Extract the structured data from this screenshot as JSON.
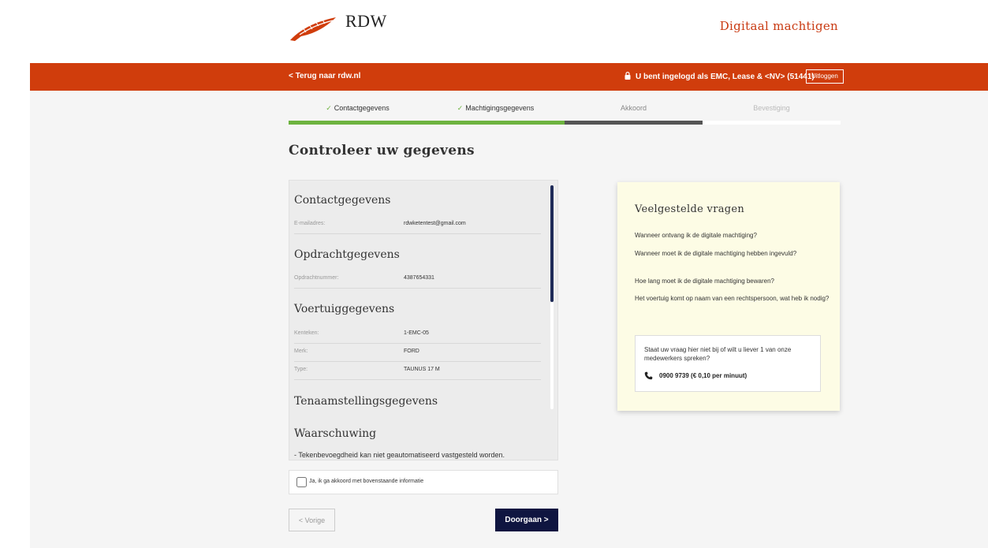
{
  "header": {
    "logo_text": "RDW",
    "app_title": "Digitaal machtigen"
  },
  "navbar": {
    "back_link": "< Terug naar rdw.nl",
    "login_info": "U bent ingelogd als EMC, Lease & <NV> (51441)",
    "logout_label": "Uitloggen"
  },
  "steps": [
    {
      "label": "Contactgegevens",
      "state": "done",
      "progress": 1.0
    },
    {
      "label": "Machtigingsgegevens",
      "state": "done",
      "progress": 1.0
    },
    {
      "label": "Akkoord",
      "state": "current",
      "progress": 1.0
    },
    {
      "label": "Bevestiging",
      "state": "future",
      "progress": 0.0
    }
  ],
  "colors": {
    "brand_red": "#d03d0c",
    "progress_done": "#6db33f",
    "progress_current": "#555555",
    "primary_button": "#0f1540"
  },
  "page_title": "Controleer uw gegevens",
  "details": {
    "contact_title": "Contactgegevens",
    "email_label": "E-mailadres:",
    "email_value": "rdwketentest@gmail.com",
    "order_title": "Opdrachtgegevens",
    "order_label": "Opdrachtnummer:",
    "order_value": "4387654331",
    "vehicle_title": "Voertuiggegevens",
    "plate_label": "Kenteken:",
    "plate_value": "1-EMC-05",
    "brand_label": "Merk:",
    "brand_value": "FORD",
    "type_label": "Type:",
    "type_value": "TAUNUS 17 M",
    "registration_title": "Tenaamstellingsgegevens",
    "warning_title": "Waarschuwing",
    "warning_text": "- Tekenbevoegdheid kan niet geautomatiseerd vastgesteld worden."
  },
  "agree_label": "Ja, ik ga akkoord met bovenstaande informatie",
  "buttons": {
    "prev": "< Vorige",
    "next": "Doorgaan  >"
  },
  "faq": {
    "title": "Veelgestelde vragen",
    "questions": [
      "Wanneer ontvang ik de digitale machtiging?",
      "Wanneer moet ik de digitale machtiging hebben ingevuld?",
      "Hoe lang moet ik de digitale machtiging bewaren?",
      "Het voertuig komt op naam van een rechtspersoon, wat heb ik nodig?"
    ],
    "contact_text": "Staat uw vraag hier niet bij of wilt u liever 1 van onze medewerkers spreken?",
    "phone": "0900 9739 (€ 0,10 per minuut)"
  }
}
